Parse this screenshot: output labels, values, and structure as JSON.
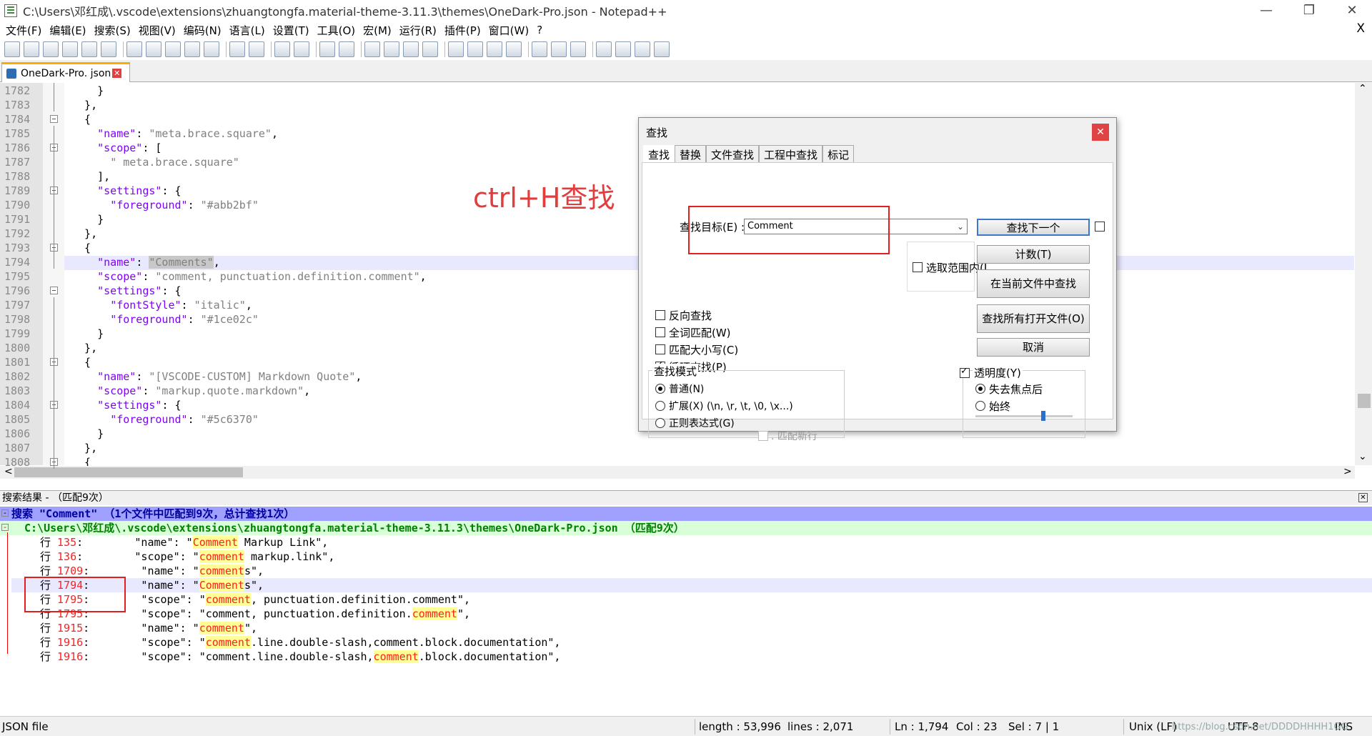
{
  "window": {
    "title": "C:\\Users\\邓红成\\.vscode\\extensions\\zhuangtongfa.material-theme-3.11.3\\themes\\OneDark-Pro.json - Notepad++",
    "minimize": "—",
    "maximize": "❐",
    "close": "✕"
  },
  "menu": [
    "文件(F)",
    "编辑(E)",
    "搜索(S)",
    "视图(V)",
    "编码(N)",
    "语言(L)",
    "设置(T)",
    "工具(O)",
    "宏(M)",
    "运行(R)",
    "插件(P)",
    "窗口(W)",
    "?"
  ],
  "menu_close": "X",
  "tab": {
    "label": "OneDark-Pro. json",
    "close": "✕"
  },
  "editor": {
    "lines": [
      {
        "n": "1782",
        "code": [
          [
            "    }",
            "p"
          ]
        ]
      },
      {
        "n": "1783",
        "code": [
          [
            "  },",
            "p"
          ]
        ]
      },
      {
        "n": "1784",
        "code": [
          [
            "  {",
            "p"
          ]
        ]
      },
      {
        "n": "1785",
        "code": [
          [
            "    ",
            "p"
          ],
          [
            "\"name\"",
            "k"
          ],
          [
            ": ",
            "p"
          ],
          [
            "\"meta.brace.square\"",
            "s"
          ],
          [
            ",",
            "p"
          ]
        ]
      },
      {
        "n": "1786",
        "code": [
          [
            "    ",
            "p"
          ],
          [
            "\"scope\"",
            "k"
          ],
          [
            ": [",
            "p"
          ]
        ]
      },
      {
        "n": "1787",
        "code": [
          [
            "      ",
            "p"
          ],
          [
            "\" meta.brace.square\"",
            "s"
          ]
        ]
      },
      {
        "n": "1788",
        "code": [
          [
            "    ],",
            "p"
          ]
        ]
      },
      {
        "n": "1789",
        "code": [
          [
            "    ",
            "p"
          ],
          [
            "\"settings\"",
            "k"
          ],
          [
            ": {",
            "p"
          ]
        ]
      },
      {
        "n": "1790",
        "code": [
          [
            "      ",
            "p"
          ],
          [
            "\"foreground\"",
            "k"
          ],
          [
            ": ",
            "p"
          ],
          [
            "\"#abb2bf\"",
            "s"
          ]
        ]
      },
      {
        "n": "1791",
        "code": [
          [
            "    }",
            "p"
          ]
        ]
      },
      {
        "n": "1792",
        "code": [
          [
            "  },",
            "p"
          ]
        ]
      },
      {
        "n": "1793",
        "code": [
          [
            "  {",
            "p"
          ]
        ]
      },
      {
        "n": "1794",
        "code": [
          [
            "    ",
            "p"
          ],
          [
            "\"name\"",
            "k"
          ],
          [
            ": ",
            "p"
          ],
          [
            "\"Comments\"",
            "s"
          ],
          [
            ",",
            "p"
          ]
        ]
      },
      {
        "n": "1795",
        "code": [
          [
            "    ",
            "p"
          ],
          [
            "\"scope\"",
            "k"
          ],
          [
            ": ",
            "p"
          ],
          [
            "\"comment, punctuation.definition.comment\"",
            "s"
          ],
          [
            ",",
            "p"
          ]
        ]
      },
      {
        "n": "1796",
        "code": [
          [
            "    ",
            "p"
          ],
          [
            "\"settings\"",
            "k"
          ],
          [
            ": {",
            "p"
          ]
        ]
      },
      {
        "n": "1797",
        "code": [
          [
            "      ",
            "p"
          ],
          [
            "\"fontStyle\"",
            "k"
          ],
          [
            ": ",
            "p"
          ],
          [
            "\"italic\"",
            "s"
          ],
          [
            ",",
            "p"
          ]
        ]
      },
      {
        "n": "1798",
        "code": [
          [
            "      ",
            "p"
          ],
          [
            "\"foreground\"",
            "k"
          ],
          [
            ": ",
            "p"
          ],
          [
            "\"#1ce02c\"",
            "s"
          ]
        ]
      },
      {
        "n": "1799",
        "code": [
          [
            "    }",
            "p"
          ]
        ]
      },
      {
        "n": "1800",
        "code": [
          [
            "  },",
            "p"
          ]
        ]
      },
      {
        "n": "1801",
        "code": [
          [
            "  {",
            "p"
          ]
        ]
      },
      {
        "n": "1802",
        "code": [
          [
            "    ",
            "p"
          ],
          [
            "\"name\"",
            "k"
          ],
          [
            ": ",
            "p"
          ],
          [
            "\"[VSCODE-CUSTOM] Markdown Quote\"",
            "s"
          ],
          [
            ",",
            "p"
          ]
        ]
      },
      {
        "n": "1803",
        "code": [
          [
            "    ",
            "p"
          ],
          [
            "\"scope\"",
            "k"
          ],
          [
            ": ",
            "p"
          ],
          [
            "\"markup.quote.markdown\"",
            "s"
          ],
          [
            ",",
            "p"
          ]
        ]
      },
      {
        "n": "1804",
        "code": [
          [
            "    ",
            "p"
          ],
          [
            "\"settings\"",
            "k"
          ],
          [
            ": {",
            "p"
          ]
        ]
      },
      {
        "n": "1805",
        "code": [
          [
            "      ",
            "p"
          ],
          [
            "\"foreground\"",
            "k"
          ],
          [
            ": ",
            "p"
          ],
          [
            "\"#5c6370\"",
            "s"
          ]
        ]
      },
      {
        "n": "1806",
        "code": [
          [
            "    }",
            "p"
          ]
        ]
      },
      {
        "n": "1807",
        "code": [
          [
            "  },",
            "p"
          ]
        ]
      },
      {
        "n": "1808",
        "code": [
          [
            "  {",
            "p"
          ]
        ]
      }
    ],
    "scroll_up": "⌃",
    "scroll_down": "⌄",
    "scroll_left": "<",
    "scroll_right": ">"
  },
  "annotation": "ctrl+H查找",
  "find_dialog": {
    "title": "查找",
    "close": "✕",
    "tabs": [
      "查找",
      "替换",
      "文件查找",
      "工程中查找",
      "标记"
    ],
    "target_label": "查找目标(E) :",
    "target_value": "Comment",
    "buttons": {
      "find_next": "查找下一个",
      "count": "计数(T)",
      "find_in_current": "在当前文件中查找",
      "find_all_open": "查找所有打开文件(O)",
      "cancel": "取消"
    },
    "in_selection": "选取范围内(I",
    "options": [
      {
        "label": "反向查找",
        "checked": false
      },
      {
        "label": "全词匹配(W)",
        "checked": false
      },
      {
        "label": "匹配大小写(C)",
        "checked": false
      },
      {
        "label": "循环查找(P)",
        "checked": true
      }
    ],
    "mode_title": "查找模式",
    "modes": [
      {
        "label": "普通(N)",
        "selected": true
      },
      {
        "label": "扩展(X) (\\n, \\r, \\t, \\0, \\x...)",
        "selected": false
      },
      {
        "label": "正则表达式(G)",
        "selected": false
      }
    ],
    "match_newline": ". 匹配新行",
    "transparency": {
      "label": "透明度(Y)",
      "checked": true
    },
    "trans_modes": [
      {
        "label": "失去焦点后",
        "selected": true
      },
      {
        "label": "始终",
        "selected": false
      }
    ],
    "slider_level": 0.7
  },
  "results": {
    "header": "搜索结果 - （匹配9次）",
    "close": "✕",
    "summary": "搜索 \"Comment\" （1个文件中匹配到9次，总计查找1次）",
    "file_line": "C:\\Users\\邓红成\\.vscode\\extensions\\zhuangtongfa.material-theme-3.11.3\\themes\\OneDark-Pro.json （匹配9次）",
    "rows": [
      {
        "prefix": "行 ",
        "num": "135",
        "pre": ":        \"name\": \"",
        "hit": "Comment",
        "post": " Markup Link\","
      },
      {
        "prefix": "行 ",
        "num": "136",
        "pre": ":        \"scope\": \"",
        "hit": "comment",
        "post": " markup.link\","
      },
      {
        "prefix": "行 ",
        "num": "1709",
        "pre": ":        \"name\": \"",
        "hit": "comment",
        "post": "s\","
      },
      {
        "prefix": "行 ",
        "num": "1794",
        "pre": ":        \"name\": \"",
        "hit": "Comment",
        "post": "s\","
      },
      {
        "prefix": "行 ",
        "num": "1795",
        "pre": ":        \"scope\": \"",
        "hit": "comment",
        "post": ", punctuation.definition.comment\","
      },
      {
        "prefix": "行 ",
        "num": "1795",
        "pre": ":        \"scope\": \"comment, punctuation.definition.",
        "hit": "comment",
        "post": "\","
      },
      {
        "prefix": "行 ",
        "num": "1915",
        "pre": ":        \"name\": \"",
        "hit": "comment",
        "post": "\","
      },
      {
        "prefix": "行 ",
        "num": "1916",
        "pre": ":        \"scope\": \"",
        "hit": "comment",
        "post": ".line.double-slash,comment.block.documentation\","
      },
      {
        "prefix": "行 ",
        "num": "1916",
        "pre": ":        \"scope\": \"comment.line.double-slash,",
        "hit": "comment",
        "post": ".block.documentation\","
      }
    ]
  },
  "status": {
    "type": "JSON file",
    "length": "length : 53,996",
    "lines": "lines : 2,071",
    "ln": "Ln : 1,794",
    "col": "Col : 23",
    "sel": "Sel : 7 | 1",
    "eol": "Unix (LF)",
    "enc": "UTF-8",
    "ins": "INS",
    "watermark": "https://blog.csdn.net/DDDDHHHH1GG"
  }
}
